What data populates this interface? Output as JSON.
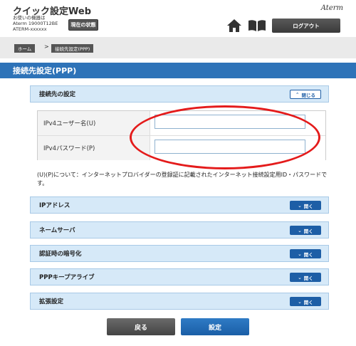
{
  "header": {
    "app_title": "クイック設定Web",
    "device_info_line1": "お使いの機器は",
    "device_info_line2": "Aterm 19000T12BE",
    "device_info_line3": "ATERM-xxxxxx",
    "status_button": "現在の状態",
    "brand": "Aterm",
    "logout_button": "ログアウト"
  },
  "breadcrumb": {
    "home": "ホーム",
    "separator": ">",
    "current": "接続先設定(PPP)"
  },
  "page_title": "接続先設定(PPP)",
  "connection_section": {
    "label": "接続先の設定",
    "toggle": "閉じる",
    "fields": [
      {
        "label": "IPv4ユーザー名(U)",
        "value": ""
      },
      {
        "label": "IPv4パスワード(P)",
        "value": ""
      }
    ]
  },
  "note": "(U)(P)について：インターネットプロバイダーの登録証に記載されたインターネット接続設定用ID・パスワードです。",
  "sections": [
    {
      "label": "IPアドレス",
      "toggle": "開く"
    },
    {
      "label": "ネームサーバ",
      "toggle": "開く"
    },
    {
      "label": "認証時の暗号化",
      "toggle": "開く"
    },
    {
      "label": "PPPキープアライブ",
      "toggle": "開く"
    },
    {
      "label": "拡張設定",
      "toggle": "開く"
    }
  ],
  "buttons": {
    "back": "戻る",
    "save": "設定"
  },
  "colors": {
    "title_bar": "#2e73b8",
    "panel_bg": "#d6e9f8",
    "highlight": "#e41b1b"
  }
}
